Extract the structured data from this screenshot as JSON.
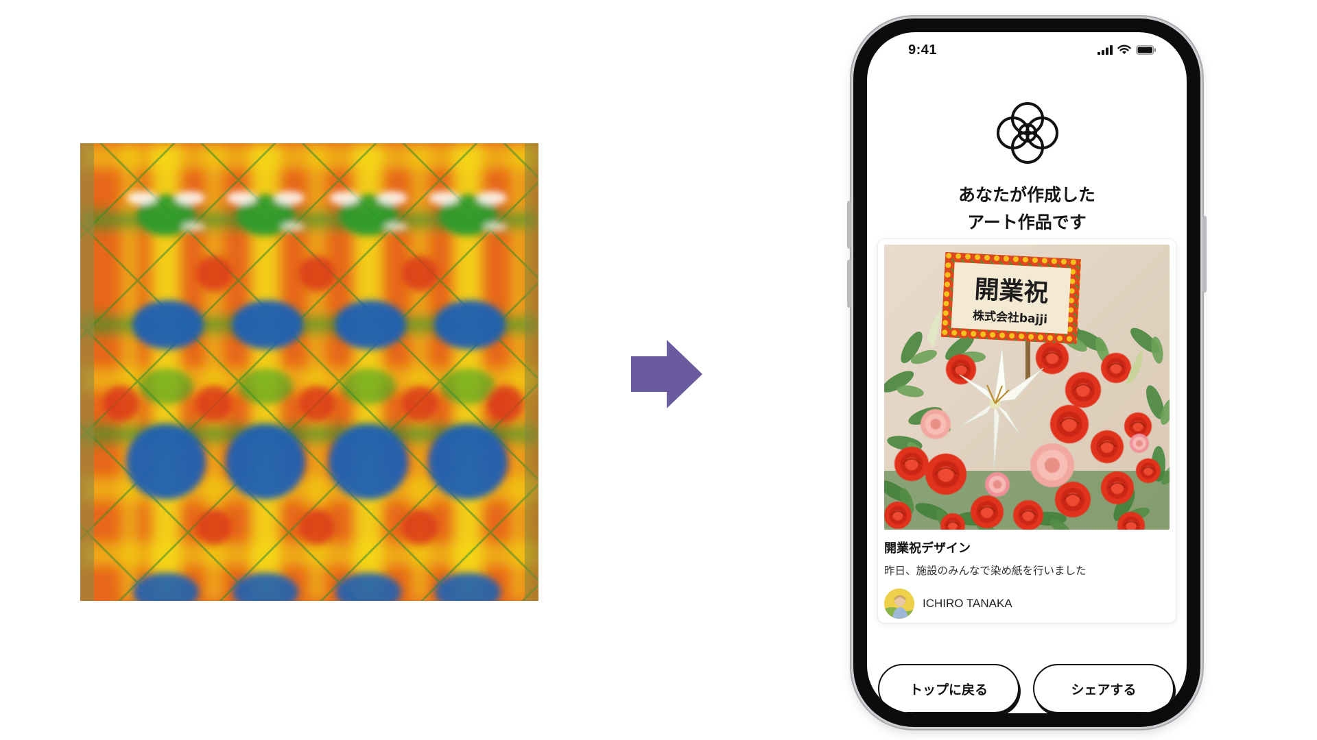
{
  "status_bar": {
    "time": "9:41",
    "icons": [
      "cellular-signal-icon",
      "wifi-icon",
      "battery-icon"
    ]
  },
  "app": {
    "logo_icon": "overlapping-circles-flower-logo"
  },
  "headline": {
    "line1": "あなたが作成した",
    "line2": "アート作品です"
  },
  "artwork_card": {
    "sign_title": "開業祝",
    "sign_subtitle": "株式会社bajji",
    "title": "開業祝デザイン",
    "description": "昨日、施設のみんなで染め紙を行いました",
    "author": "ICHIRO TANAKA"
  },
  "buttons": {
    "back_to_top": "トップに戻る",
    "share": "シェアする"
  },
  "colors": {
    "arrow": "#6a5b9e",
    "phone_frame": "#0c0c0c",
    "button_border": "#111111",
    "dye_red": "#d9361c",
    "dye_yellow": "#f4dd14",
    "dye_green": "#2a9a2c",
    "dye_blue": "#1f60b3",
    "rose_red": "#e1321f",
    "carnation_pink": "#f2a8a0"
  }
}
